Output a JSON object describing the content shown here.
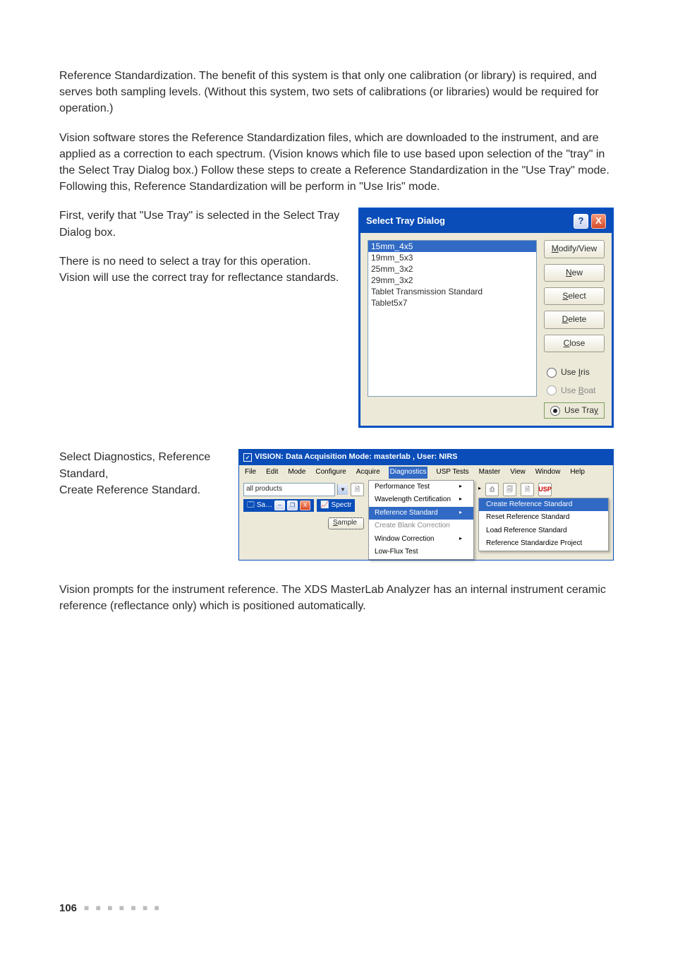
{
  "para1": "Reference Standardization. The benefit of this system is that only one calibration (or library) is required, and serves both sampling levels. (Without this system, two sets of calibrations (or libraries) would be required for operation.)",
  "para2": "Vision software stores the Reference Standardization files, which are downloaded to the instrument, and are applied as a correction to each spectrum. (Vision knows which file to use based upon selection of the \"tray\" in the Select Tray Dialog box.) Follow these steps to create a Reference Standardization in the \"Use Tray\" mode. Following this, Reference Standardization will be perform in \"Use Iris\" mode.",
  "row1": {
    "t1": "First, verify that \"Use Tray\" is selected in the Select Tray Dialog box.",
    "t2": "There is no need to select a tray for this operation. Vision will use the correct tray for reflectance standards."
  },
  "dialog": {
    "title": "Select Tray Dialog",
    "help_glyph": "?",
    "close_glyph": "X",
    "items": [
      "15mm_4x5",
      "19mm_5x3",
      "25mm_3x2",
      "29mm_3x2",
      "Tablet Transmission Standard",
      "Tablet5x7"
    ],
    "selected_index": 0,
    "buttons": {
      "modify": "Modify/View",
      "new": "New",
      "select": "Select",
      "delete": "Delete",
      "close": "Close"
    },
    "radios": {
      "iris": "Use Iris",
      "boat": "Use Boat",
      "tray": "Use Tray"
    }
  },
  "row2": {
    "lines": [
      "Select Diagnostics, Reference Standard,",
      "Create Reference Standard."
    ]
  },
  "vision": {
    "title": "VISION: Data Acquisition Mode: masterlab , User: NIRS",
    "menus": [
      "File",
      "Edit",
      "Mode",
      "Configure",
      "Acquire",
      "Diagnostics",
      "USP Tests",
      "Master",
      "View",
      "Window",
      "Help"
    ],
    "selected_menu": "Diagnostics",
    "combo_value": "all products",
    "child1_label": "Sa…",
    "child2_label": "Spectr",
    "sample_btn": "Sample",
    "usp_label": "USP",
    "dropdown": [
      {
        "label": "Performance Test",
        "arrow": true
      },
      {
        "label": "Wavelength Certification",
        "arrow": true
      },
      {
        "label": "Reference Standard",
        "arrow": true,
        "selected": true
      },
      {
        "label": "Create Blank Correction",
        "disabled": true
      },
      {
        "label": "Window Correction",
        "arrow": true
      },
      {
        "label": "Low-Flux Test"
      }
    ],
    "submenu": [
      {
        "label": "Create Reference Standard",
        "selected": true
      },
      {
        "label": "Reset Reference Standard"
      },
      {
        "label": "Load Reference Standard"
      },
      {
        "label": "Reference Standardize Project"
      }
    ]
  },
  "para3": "Vision prompts for the instrument reference. The XDS MasterLab Analyzer has an internal instrument ceramic reference (reflectance only) which is positioned automatically.",
  "footer": {
    "page": "106",
    "dots": "■ ■ ■ ■ ■ ■ ■"
  }
}
